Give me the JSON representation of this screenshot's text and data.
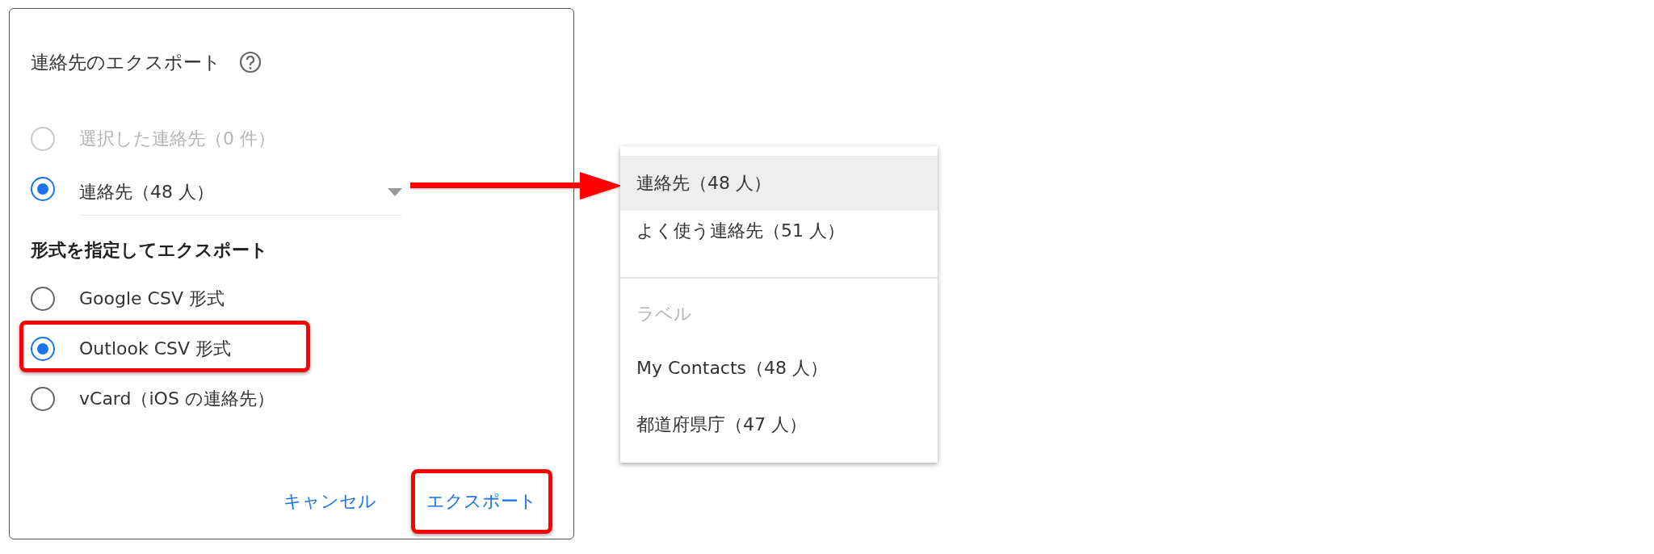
{
  "dialog": {
    "title": "連絡先のエクスポート",
    "sources": [
      {
        "label": "選択した連絡先（0 件）",
        "selected": false,
        "disabled": true,
        "kind": "plain"
      },
      {
        "label": "連絡先（48 人）",
        "selected": true,
        "disabled": false,
        "kind": "dropdown"
      }
    ],
    "format_heading": "形式を指定してエクスポート",
    "formats": [
      {
        "label": "Google CSV 形式",
        "selected": false,
        "highlighted": false
      },
      {
        "label": "Outlook CSV 形式",
        "selected": true,
        "highlighted": true
      },
      {
        "label": "vCard（iOS の連絡先）",
        "selected": false,
        "highlighted": false
      }
    ],
    "buttons": [
      {
        "label": "キャンセル",
        "highlighted": false
      },
      {
        "label": "エクスポート",
        "highlighted": true
      }
    ]
  },
  "menu": {
    "items": [
      {
        "kind": "option",
        "label": "連絡先（48 人）",
        "selected": true
      },
      {
        "kind": "option",
        "label": "よく使う連絡先（51 人）",
        "selected": false
      },
      {
        "kind": "divider"
      },
      {
        "kind": "header",
        "label": "ラベル"
      },
      {
        "kind": "option",
        "label": "My Contacts（48 人）",
        "selected": false
      },
      {
        "kind": "option",
        "label": "都道府県庁（47 人）",
        "selected": false
      }
    ]
  }
}
